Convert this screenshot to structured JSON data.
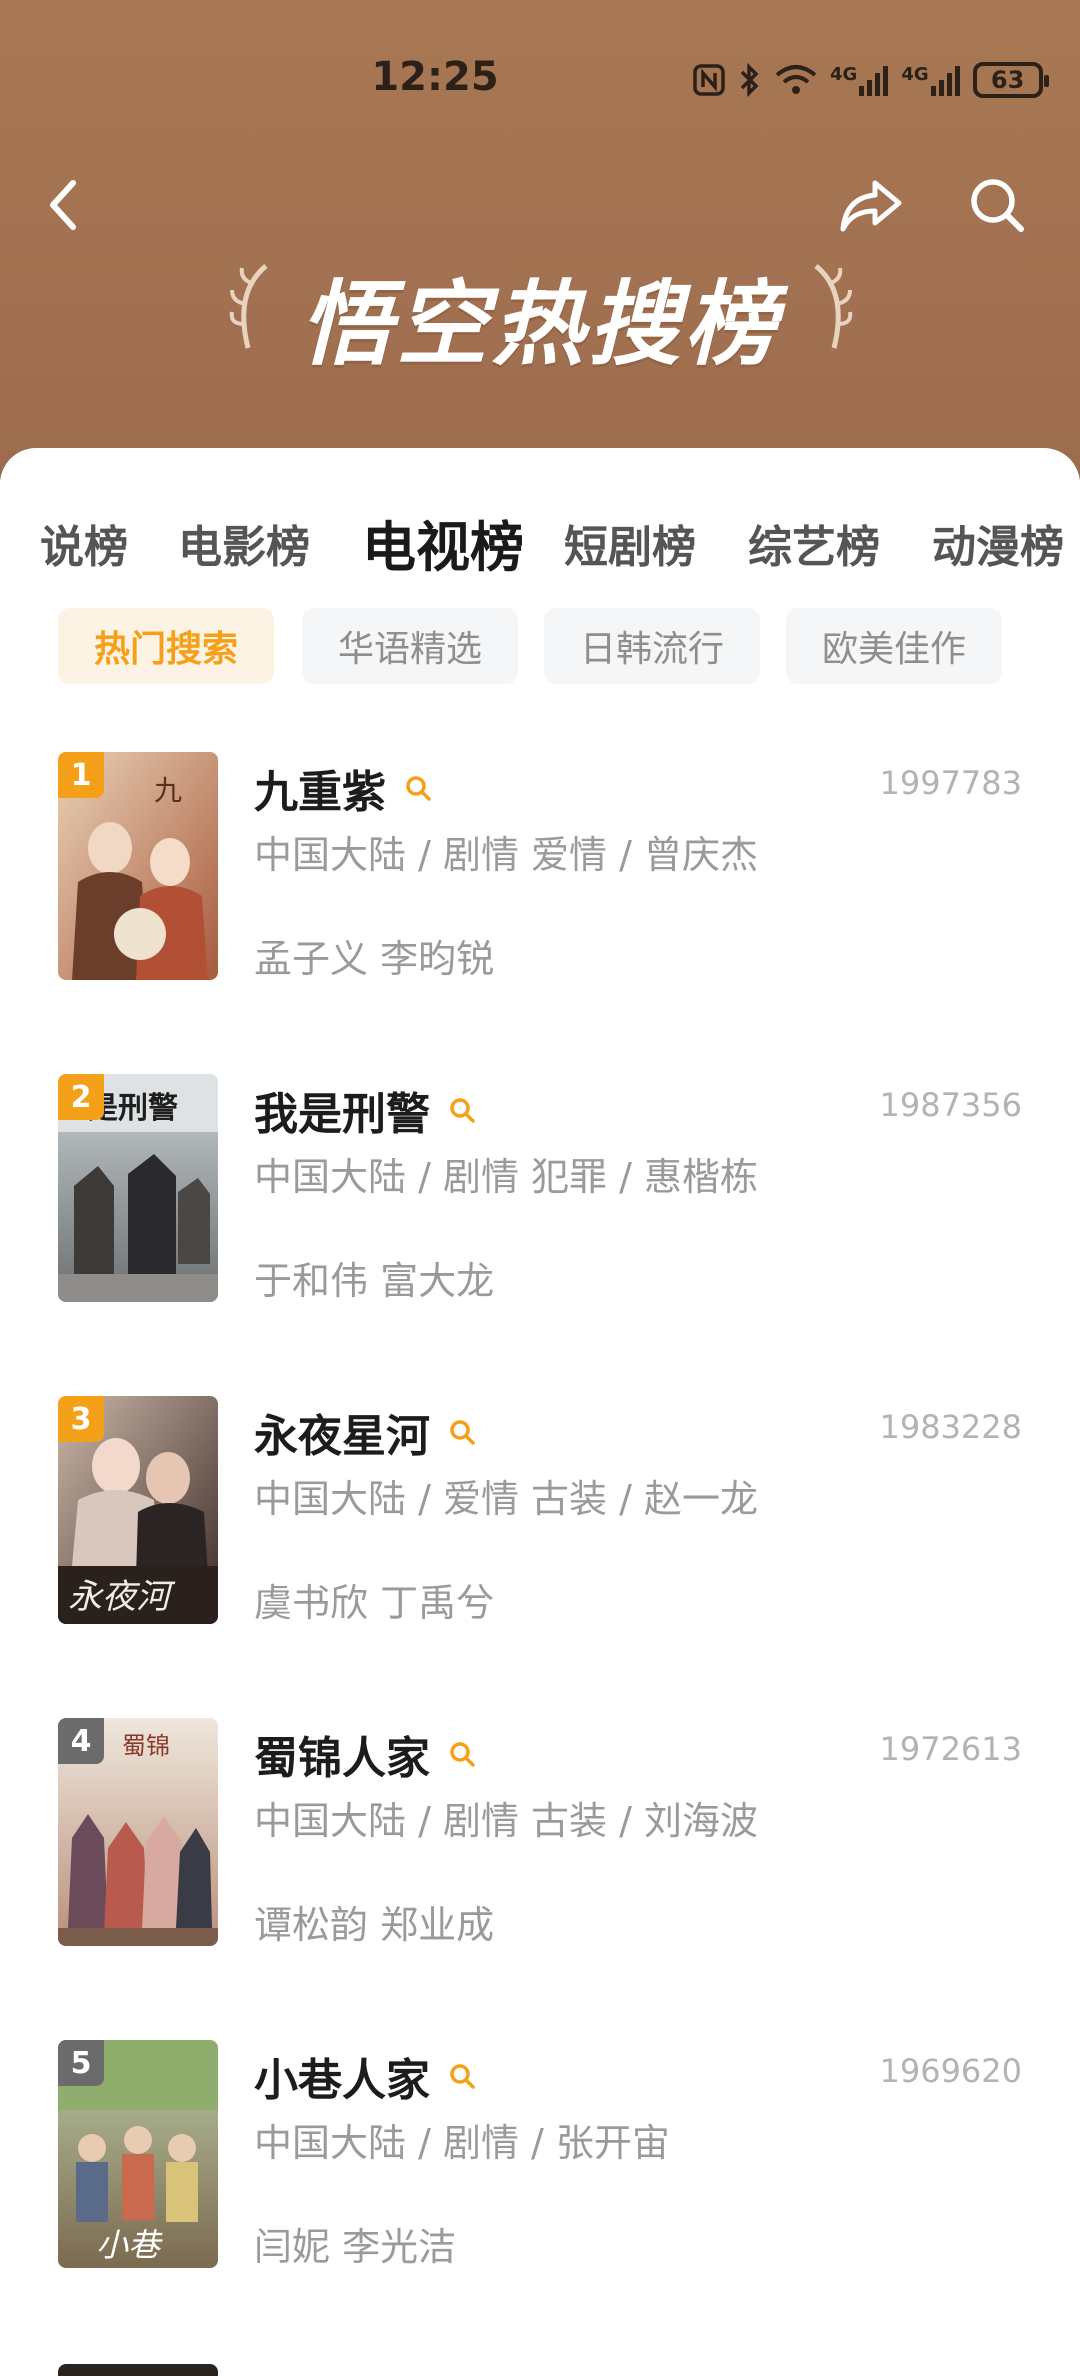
{
  "status_bar": {
    "time": "12:25",
    "network_1": "4G",
    "network_2": "4G",
    "battery": "63"
  },
  "header": {
    "title": "悟空热搜榜",
    "back_icon": "back-arrow-icon",
    "share_icon": "share-icon",
    "search_icon": "search-icon"
  },
  "category_tabs": [
    {
      "label": "说榜"
    },
    {
      "label": "电影榜"
    },
    {
      "label": "电视榜",
      "active": true
    },
    {
      "label": "短剧榜"
    },
    {
      "label": "综艺榜"
    },
    {
      "label": "动漫榜"
    }
  ],
  "sub_tabs": [
    {
      "label": "热门搜索",
      "active": true
    },
    {
      "label": "华语精选"
    },
    {
      "label": "日韩流行"
    },
    {
      "label": "欧美佳作"
    }
  ],
  "rankings": [
    {
      "rank": "1",
      "title": "九重紫",
      "meta": "中国大陆 / 剧情 爱情 / 曾庆杰",
      "cast": "孟子义 李昀锐",
      "score": "1997783"
    },
    {
      "rank": "2",
      "title": "我是刑警",
      "meta": "中国大陆 / 剧情 犯罪 / 惠楷栋",
      "cast": "于和伟 富大龙",
      "score": "1987356"
    },
    {
      "rank": "3",
      "title": "永夜星河",
      "meta": "中国大陆 / 爱情 古装 / 赵一龙",
      "cast": "虞书欣 丁禹兮",
      "score": "1983228"
    },
    {
      "rank": "4",
      "title": "蜀锦人家",
      "meta": "中国大陆 / 剧情 古装 / 刘海波",
      "cast": "谭松韵 郑业成",
      "score": "1972613"
    },
    {
      "rank": "5",
      "title": "小巷人家",
      "meta": "中国大陆 / 剧情 / 张开宙",
      "cast": "闫妮 李光洁",
      "score": "1969620"
    }
  ],
  "colors": {
    "header_bg": "#a87854",
    "accent_orange": "#f5a019",
    "rank_badge_top": "#f5a019",
    "rank_badge_other": "#6b6b6b"
  }
}
